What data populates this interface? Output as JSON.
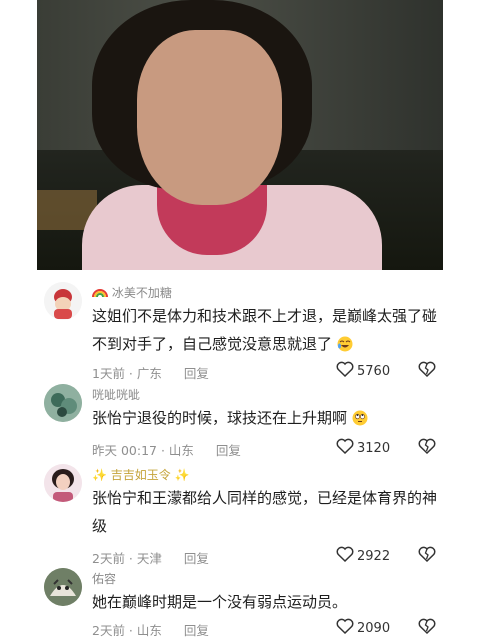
{
  "video": {
    "icon": "video-frame"
  },
  "comments": [
    {
      "username": "冰美不加糖",
      "username_prefix_icon": "rainbow-icon",
      "text": "这姐们不是体力和技术跟不上才退，是巅峰太强了碰不到对手了，自己感觉没意思就退了",
      "emoji": "laugh-cry-emoji",
      "time_location": "1天前 · 广东",
      "reply": "回复",
      "likes": "5760"
    },
    {
      "username": "咣呲咣呲",
      "text": "张怡宁退役的时候，球技还在上升期啊",
      "emoji": "eye-roll-emoji",
      "time_location": "昨天 00:17 · 山东",
      "reply": "回复",
      "likes": "3120"
    },
    {
      "username": "✨ 吉吉如玉令 ✨",
      "text": "张怡宁和王濛都给人同样的感觉，已经是体育界的神级",
      "time_location": "2天前 · 天津",
      "reply": "回复",
      "likes": "2922"
    },
    {
      "username": "佑容",
      "text": "她在巅峰时期是一个没有弱点运动员。",
      "time_location": "2天前 · 山东",
      "reply": "回复",
      "likes": "2090"
    }
  ],
  "colors": {
    "like_icon": "#333333",
    "muted_text": "#8f8f8f",
    "username": "#8a8a8a"
  }
}
